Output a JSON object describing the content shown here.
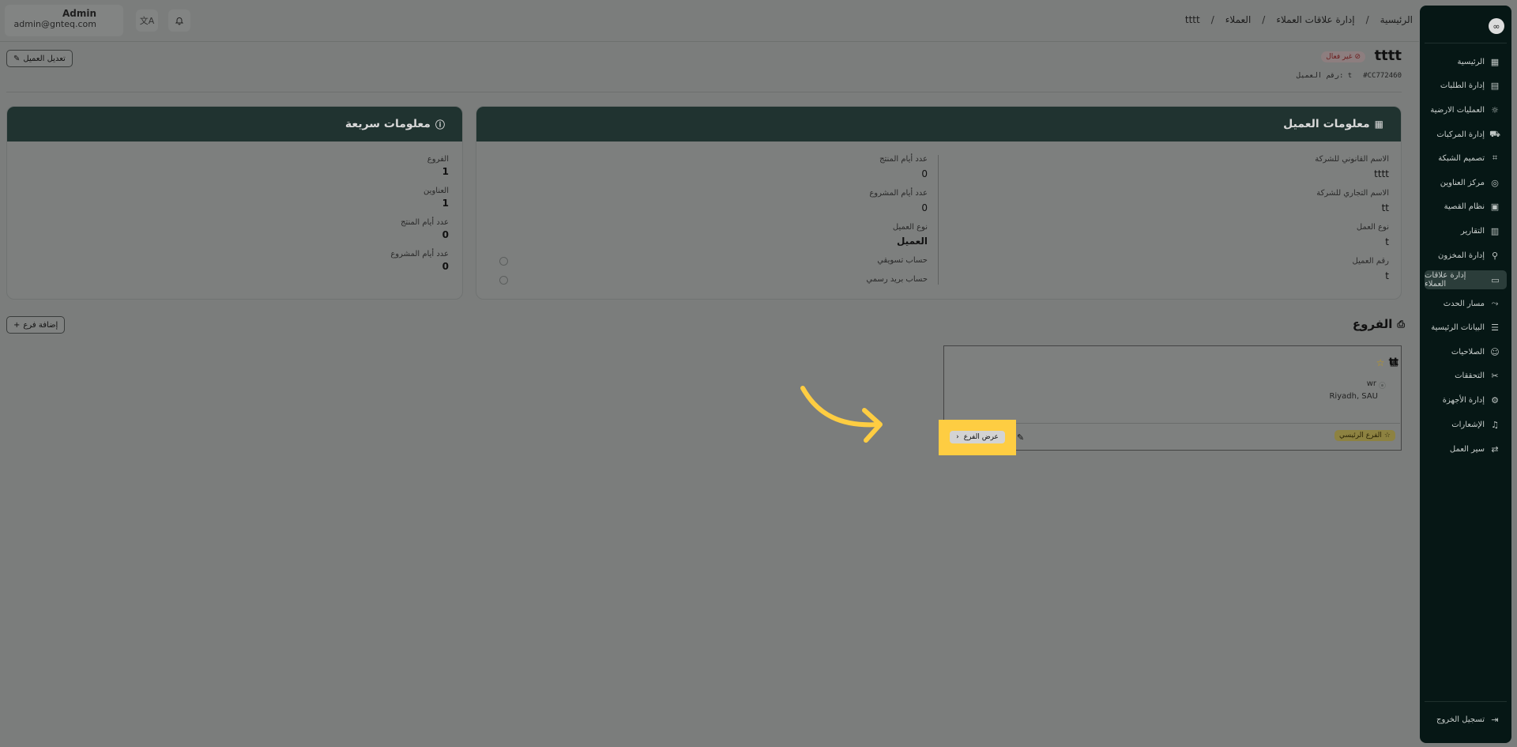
{
  "topbar": {
    "user_name": "Admin",
    "user_email": "admin@gnteq.com",
    "translate_icon": "translate-icon",
    "bell_icon": "bell-icon",
    "breadcrumb": [
      "الرئيسية",
      "إدارة علاقات العملاء",
      "العملاء",
      "tttt"
    ]
  },
  "header": {
    "edit_button": "تعديل العميل",
    "title": "tttt",
    "status": "غير فعال",
    "client_code": "#CC772460",
    "client_number_label": "رقم العميل: t"
  },
  "client_info": {
    "title": "معلومات العميل",
    "right": [
      {
        "label": "الاسم القانوني للشركة",
        "value": "tttt"
      },
      {
        "label": "الاسم التجاري للشركة",
        "value": "tt"
      },
      {
        "label": "نوع العمل",
        "value": "t"
      },
      {
        "label": "رقم العميل",
        "value": "t"
      }
    ],
    "left": [
      {
        "label": "عدد أيام المنتج",
        "value": "0"
      },
      {
        "label": "عدد أيام المشروع",
        "value": "0"
      },
      {
        "label": "نوع العميل",
        "value": "العميل"
      },
      {
        "label": "حساب تسويقي",
        "value": ""
      },
      {
        "label": "حساب بريد رسمي",
        "value": ""
      }
    ]
  },
  "quick_info": {
    "title": "معلومات سريعة",
    "items": [
      {
        "label": "الفروع",
        "value": "1"
      },
      {
        "label": "العناوين",
        "value": "1"
      },
      {
        "label": "عدد أيام المنتج",
        "value": "0"
      },
      {
        "label": "عدد أيام المشروع",
        "value": "0"
      }
    ]
  },
  "branches": {
    "title": "الفروع",
    "add_button": "إضافة فرع",
    "card": {
      "name": "tt",
      "address_line1": "wr",
      "address_line2": "Riyadh, SAU",
      "main_badge": "الفرع الرئيسي",
      "view_button": "عرض الفرع"
    }
  },
  "sidebar": {
    "items": [
      {
        "label": "الرئيسية",
        "icon": "dashboard-icon"
      },
      {
        "label": "إدارة الطلبات",
        "icon": "orders-icon"
      },
      {
        "label": "العمليات الارضية",
        "icon": "ground-ops-icon"
      },
      {
        "label": "إدارة المركبات",
        "icon": "truck-icon"
      },
      {
        "label": "تصميم الشبكة",
        "icon": "network-icon"
      },
      {
        "label": "مركز العناوين",
        "icon": "location-icon"
      },
      {
        "label": "نظام القصية",
        "icon": "system-icon"
      },
      {
        "label": "التقارير",
        "icon": "reports-icon"
      },
      {
        "label": "إدارة المخزون",
        "icon": "inventory-icon"
      },
      {
        "label": "إدارة علاقات العملاء",
        "icon": "crm-icon"
      },
      {
        "label": "مسار الحدث",
        "icon": "route-icon"
      },
      {
        "label": "البيانات الرئيسية",
        "icon": "database-icon"
      },
      {
        "label": "الصلاحيات",
        "icon": "users-icon"
      },
      {
        "label": "التحققات",
        "icon": "tools-icon"
      },
      {
        "label": "إدارة الأجهزة",
        "icon": "device-icon"
      },
      {
        "label": "الإشعارات",
        "icon": "bell-icon"
      },
      {
        "label": "سير العمل",
        "icon": "workflow-icon"
      }
    ],
    "active_index": 9,
    "logout": "تسجيل الخروج"
  },
  "colors": {
    "overlay": "#7b7d7c",
    "sidebar": "#061715",
    "card_header": "#203330",
    "highlight": "#fecd42",
    "arrow": "#fecd42"
  }
}
